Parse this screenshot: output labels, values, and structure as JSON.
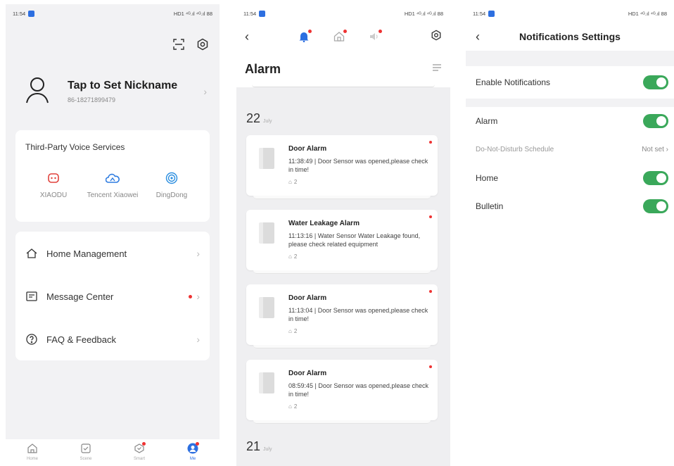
{
  "status": {
    "time": "11:54",
    "right": "HD1 ⁴ᴳ.ıl ⁴ᴳ.ıl 88"
  },
  "me": {
    "nickname": "Tap to Set Nickname",
    "phone": "86-18271899479",
    "voice_title": "Third-Party Voice Services",
    "services": [
      {
        "name": "XIAODU",
        "icon": "xiaodu-icon",
        "color": "#e0413b"
      },
      {
        "name": "Tencent Xiaowei",
        "icon": "tencent-icon",
        "color": "#2d7be0"
      },
      {
        "name": "DingDong",
        "icon": "dingdong-icon",
        "color": "#2d8fe0"
      }
    ],
    "menu": [
      {
        "label": "Home Management",
        "icon": "home-outline-icon",
        "badge": false
      },
      {
        "label": "Message Center",
        "icon": "message-icon",
        "badge": true
      },
      {
        "label": "FAQ & Feedback",
        "icon": "help-icon",
        "badge": false
      }
    ],
    "tabs": [
      {
        "label": "Home",
        "icon": "home-tab-icon",
        "active": false
      },
      {
        "label": "Scene",
        "icon": "scene-tab-icon",
        "active": false
      },
      {
        "label": "Smart",
        "icon": "smart-tab-icon",
        "active": false
      },
      {
        "label": "Me",
        "icon": "me-tab-icon",
        "active": true
      }
    ]
  },
  "alarm_page": {
    "title": "Alarm",
    "groups": [
      {
        "day": "22",
        "month": "July"
      },
      {
        "day": "21",
        "month": "July"
      }
    ],
    "items": [
      {
        "title": "Door Alarm",
        "desc": "11:38:49 | Door Sensor was opened,please check in time!",
        "home": "2"
      },
      {
        "title": "Water Leakage Alarm",
        "desc": "11:13:16 | Water Sensor Water Leakage found, please check related equipment",
        "home": "2"
      },
      {
        "title": "Door Alarm",
        "desc": "11:13:04 | Door Sensor was opened,please check in time!",
        "home": "2"
      },
      {
        "title": "Door Alarm",
        "desc": "08:59:45 | Door Sensor was opened,please check in time!",
        "home": "2"
      }
    ]
  },
  "notif_settings": {
    "title": "Notifications Settings",
    "enable_label": "Enable Notifications",
    "alarm_label": "Alarm",
    "dnd_label": "Do-Not-Disturb Schedule",
    "dnd_value": "Not set",
    "home_label": "Home",
    "bulletin_label": "Bulletin"
  },
  "colors": {
    "accent": "#2d6fe0",
    "toggle_on": "#3aa85a",
    "badge": "#e33333"
  }
}
